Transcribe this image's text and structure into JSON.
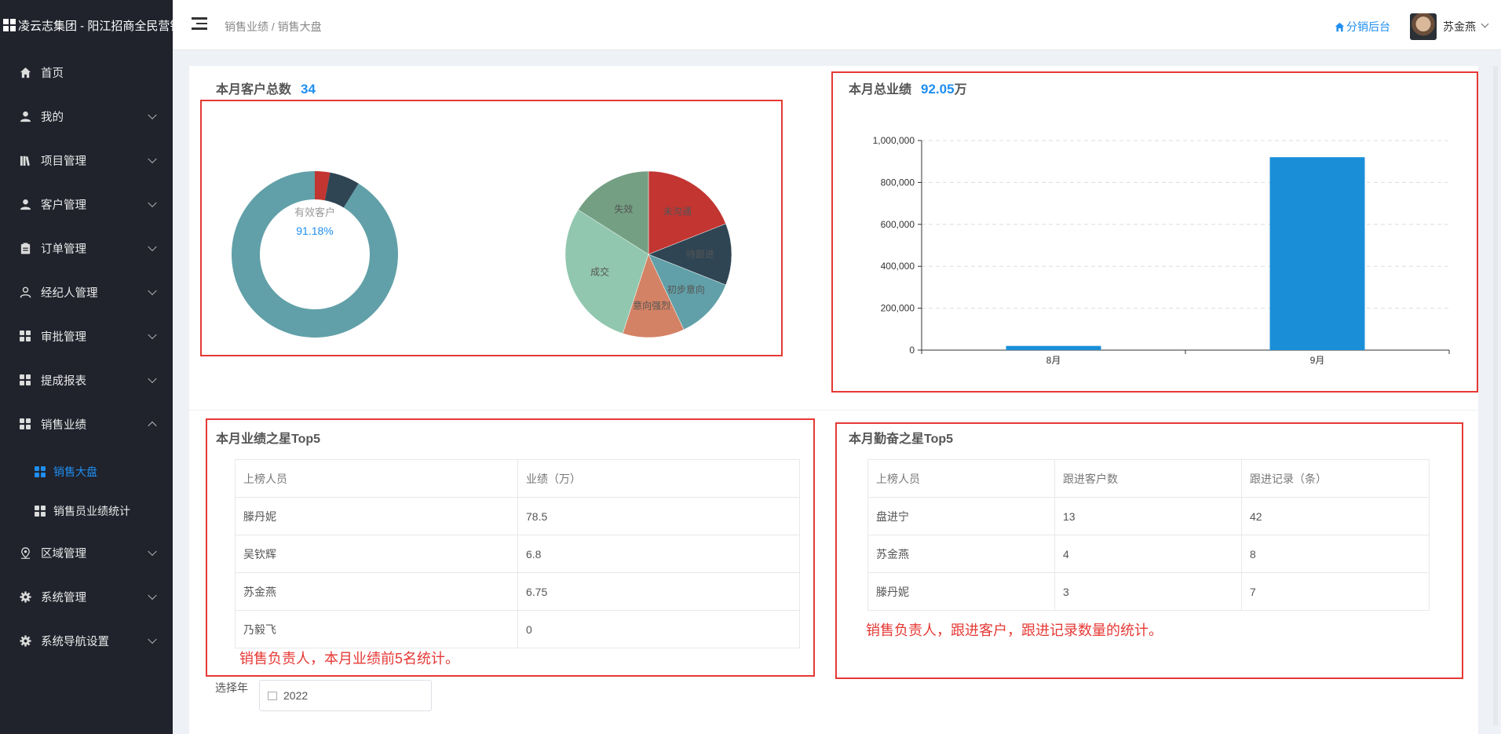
{
  "app": {
    "brand": "凌云志集团 - 阳江招商全民营销"
  },
  "sidebar": {
    "items": [
      {
        "label": "首页",
        "icon": "home-icon",
        "expandable": false
      },
      {
        "label": "我的",
        "icon": "user-icon",
        "expandable": true
      },
      {
        "label": "项目管理",
        "icon": "book-icon",
        "expandable": true
      },
      {
        "label": "客户管理",
        "icon": "user-icon",
        "expandable": true
      },
      {
        "label": "订单管理",
        "icon": "clipboard-icon",
        "expandable": true
      },
      {
        "label": "经纪人管理",
        "icon": "user-outline-icon",
        "expandable": true
      },
      {
        "label": "审批管理",
        "icon": "grid-icon",
        "expandable": true
      },
      {
        "label": "提成报表",
        "icon": "grid-icon",
        "expandable": true
      },
      {
        "label": "销售业绩",
        "icon": "grid-icon",
        "expandable": true,
        "expanded": true
      }
    ],
    "subitems": [
      {
        "label": "销售大盘",
        "active": true
      },
      {
        "label": "销售员业绩统计",
        "active": false
      }
    ],
    "items_after": [
      {
        "label": "区域管理",
        "icon": "location-icon"
      },
      {
        "label": "系统管理",
        "icon": "gear-icon"
      },
      {
        "label": "系统导航设置",
        "icon": "gear-icon"
      }
    ]
  },
  "header": {
    "breadcrumb": "销售业绩 / 销售大盘",
    "distribution_link": "分销后台",
    "username": "苏金燕"
  },
  "customers": {
    "title": "本月客户总数",
    "total": "34",
    "donut_label": "有效客户",
    "donut_value": "91.18%"
  },
  "performance": {
    "title": "本月总业绩",
    "total": "92.05",
    "unit": "万"
  },
  "top_sales": {
    "title": "本月业绩之星Top5",
    "headers": [
      "上榜人员",
      "业绩（万）"
    ],
    "rows": [
      [
        "滕丹妮",
        "78.5"
      ],
      [
        "吴钦辉",
        "6.8"
      ],
      [
        "苏金燕",
        "6.75"
      ],
      [
        "乃毅飞",
        "0"
      ]
    ],
    "note": "销售负责人，本月业绩前5名统计。"
  },
  "top_diligent": {
    "title": "本月勤奋之星Top5",
    "headers": [
      "上榜人员",
      "跟进客户数",
      "跟进记录（条）"
    ],
    "rows": [
      [
        "盘进宁",
        "13",
        "42"
      ],
      [
        "苏金燕",
        "4",
        "8"
      ],
      [
        "滕丹妮",
        "3",
        "7"
      ]
    ],
    "note": "销售负责人，跟进客户，跟进记录数量的统计。"
  },
  "year_filter": {
    "label": "选择年",
    "value": "2022"
  },
  "colors": {
    "accent": "#1f8ef1",
    "highlight": "#e53935",
    "sidebar": "#20232c"
  },
  "chart_data": [
    {
      "type": "pie",
      "variant": "donut",
      "slices": [
        {
          "value": 91.18,
          "color": "#61a0a8"
        },
        {
          "value": 5.88,
          "color": "#2f4554"
        },
        {
          "value": 2.94,
          "color": "#c23531"
        }
      ],
      "center_label": "有效客户",
      "center_value": "91.18%"
    },
    {
      "type": "pie",
      "slices": [
        {
          "name": "未沟通",
          "value": 19,
          "color": "#c23531"
        },
        {
          "name": "待跟进",
          "value": 12,
          "color": "#2f4554"
        },
        {
          "name": "初步意向",
          "value": 12,
          "color": "#61a0a8"
        },
        {
          "name": "意向强烈",
          "value": 12,
          "color": "#d48265"
        },
        {
          "name": "成交",
          "value": 29,
          "color": "#91c7ae"
        },
        {
          "name": "失效",
          "value": 16,
          "color": "#749f83"
        }
      ]
    },
    {
      "type": "bar",
      "categories": [
        "8月",
        "9月"
      ],
      "values": [
        20000,
        920500
      ],
      "ylim": [
        0,
        1000000
      ],
      "yticks": [
        "0",
        "200,000",
        "400,000",
        "600,000",
        "800,000",
        "1,000,000"
      ],
      "grid": true,
      "color": "#1a8fd8"
    }
  ]
}
